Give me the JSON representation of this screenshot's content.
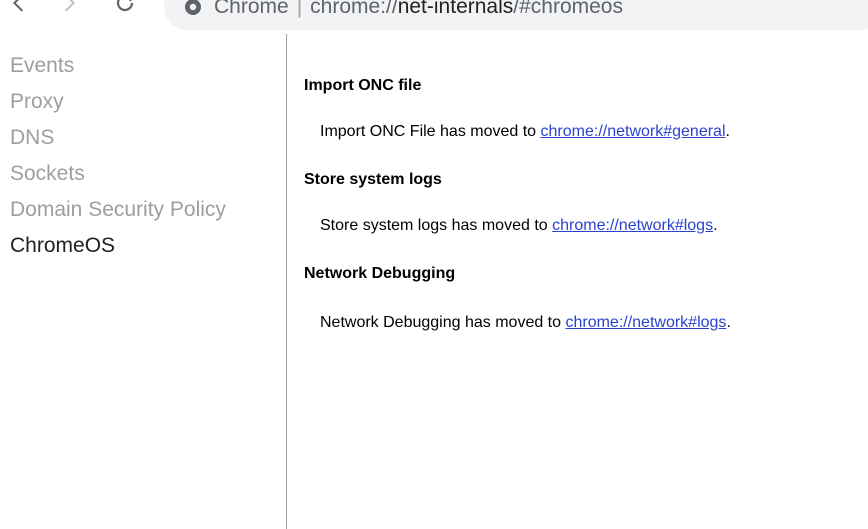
{
  "browser": {
    "omnibox": {
      "site_label": "Chrome",
      "separator": "|",
      "url_scheme": "chrome://",
      "url_host": "net-internals",
      "url_rest": "/#chromeos"
    }
  },
  "sidebar": {
    "items": [
      {
        "label": "Events",
        "active": false
      },
      {
        "label": "Proxy",
        "active": false
      },
      {
        "label": "DNS",
        "active": false
      },
      {
        "label": "Sockets",
        "active": false
      },
      {
        "label": "Domain Security Policy",
        "active": false
      },
      {
        "label": "ChromeOS",
        "active": true
      }
    ]
  },
  "main": {
    "sections": [
      {
        "title": "Import ONC file",
        "text": "Import ONC File has moved to ",
        "link": "chrome://network#general",
        "suffix": "."
      },
      {
        "title": "Store system logs",
        "text": "Store system logs has moved to ",
        "link": "chrome://network#logs",
        "suffix": "."
      },
      {
        "title": "Network Debugging",
        "text": "Network Debugging has moved to ",
        "link": "chrome://network#logs",
        "suffix": "."
      }
    ]
  },
  "colors": {
    "sidebar_inactive": "#9e9e9e",
    "sidebar_active": "#202124",
    "link": "#2a43cf",
    "divider": "#9e9e9e"
  }
}
